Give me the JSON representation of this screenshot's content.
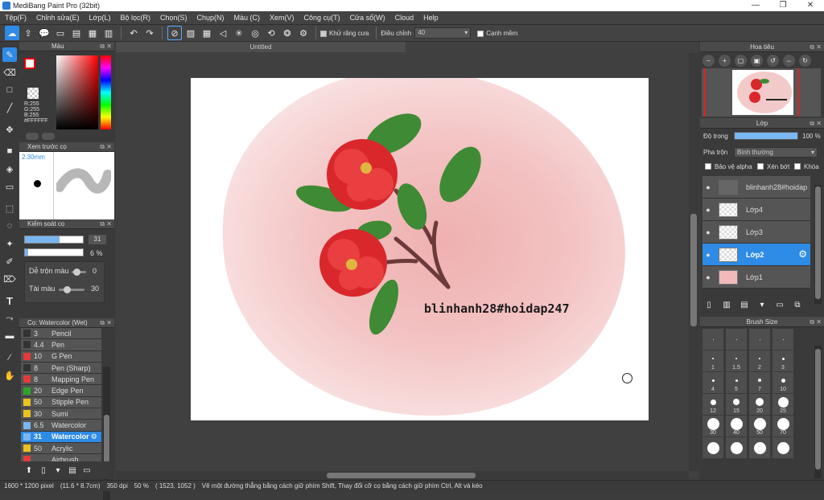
{
  "window": {
    "title": "MediBang Paint Pro (32bit)",
    "min": "—",
    "max": "❐",
    "close": "✕"
  },
  "menu": [
    "Tệp(F)",
    "Chỉnh sửa(E)",
    "Lớp(L)",
    "Bộ lọc(R)",
    "Chọn(S)",
    "Chụp(N)",
    "Màu (C)",
    "Xem(V)",
    "Công cụ(T)",
    "Cửa sổ(W)",
    "Cloud",
    "Help"
  ],
  "toolbar": {
    "antialias_label": "Khử răng cưa",
    "adjust_label": "Điều chỉnh",
    "adjust_value": "40",
    "smooth_label": "Cạnh mềm"
  },
  "color_panel": {
    "title": "Màu",
    "r": "R:255",
    "g": "G:255",
    "b": "B:255",
    "hex": "#FFFFFF",
    "accent": "#2e8be6"
  },
  "preview_panel": {
    "title": "Xem trước cọ",
    "size": "2.30mm"
  },
  "brush_control": {
    "title": "Kiểm soát cọ",
    "size_value": "31",
    "opacity_value": "6 %",
    "blend_label": "Dễ trộn màu",
    "blend_value": "0",
    "tai_label": "Tài màu",
    "tai_value": "30",
    "size_fill": 0.6,
    "opacity_fill": 0.06
  },
  "brush_list": {
    "title": "Cọ: Watercolor (Wet)",
    "items": [
      {
        "size": "3",
        "name": "Pencil",
        "color": "#333333"
      },
      {
        "size": "4.4",
        "name": "Pen",
        "color": "#333333"
      },
      {
        "size": "10",
        "name": "G Pen",
        "color": "#e33b3b"
      },
      {
        "size": "8",
        "name": "Pen (Sharp)",
        "color": "#333333"
      },
      {
        "size": "8",
        "name": "Mapping Pen",
        "color": "#e33b3b"
      },
      {
        "size": "20",
        "name": "Edge Pen",
        "color": "#2aa52a"
      },
      {
        "size": "50",
        "name": "Stipple Pen",
        "color": "#e8c21f"
      },
      {
        "size": "30",
        "name": "Sumi",
        "color": "#e8c21f"
      },
      {
        "size": "6.5",
        "name": "Watercolor",
        "color": "#7ab6f0"
      },
      {
        "size": "31",
        "name": "Watercolor",
        "color": "#7ab6f0"
      },
      {
        "size": "50",
        "name": "Acrylic",
        "color": "#e8c21f"
      },
      {
        "size": "",
        "name": "Airbrush",
        "color": "#e33b3b"
      }
    ],
    "selected_index": 9
  },
  "canvas": {
    "tab": "Untitled",
    "watermark": "blinhanh28#hoidap247"
  },
  "navigator": {
    "title": "Hoa tiêu"
  },
  "layers": {
    "title": "Lớp",
    "opacity_label": "Độ trong",
    "opacity_value": "100 %",
    "blend_label": "Pha trộn",
    "blend_value": "Bình thường",
    "protect_alpha": "Bảo vệ alpha",
    "clipping": "Xén bớt",
    "lock": "Khóa",
    "items": [
      {
        "name": "blinhanh28#hoidap"
      },
      {
        "name": "Lớp4"
      },
      {
        "name": "Lớp3"
      },
      {
        "name": "Lớp2"
      },
      {
        "name": "Lớp1"
      }
    ],
    "selected_index": 3
  },
  "brush_size": {
    "title": "Brush Size",
    "sizes": [
      "",
      "",
      "",
      "",
      "",
      "1",
      "1.5",
      "2",
      "3",
      "",
      "4",
      "5",
      "7",
      "10",
      "",
      "12",
      "15",
      "20",
      "25",
      "",
      "30",
      "40",
      "50",
      "70",
      "",
      "",
      "",
      "",
      "",
      ""
    ]
  },
  "status": {
    "dimensions": "1600 * 1200 pixel",
    "physical": "(11.6 * 8.7cm)",
    "dpi": "350 dpi",
    "zoom": "50 %",
    "coords": "( 1523, 1052 )",
    "hint": "Vẽ một đường thẳng bằng cách giữ phím Shift, Thay đổi cỡ cọ bằng cách giữ phím Ctrl, Alt và kéo"
  }
}
